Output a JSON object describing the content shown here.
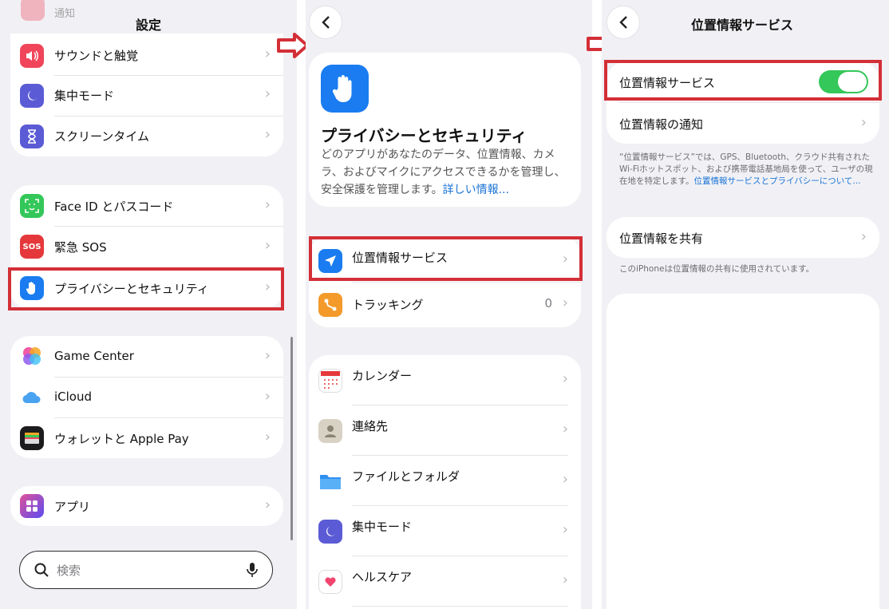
{
  "panel1": {
    "title": "設定",
    "top_partial": "通知",
    "group1": [
      {
        "label": "サウンドと触覚",
        "icon": "speaker-icon",
        "color": "#f0455a"
      },
      {
        "label": "集中モード",
        "icon": "moon-icon",
        "color": "#5b5bd6"
      },
      {
        "label": "スクリーンタイム",
        "icon": "hourglass-icon",
        "color": "#5b5bd6"
      }
    ],
    "group2": [
      {
        "label": "Face ID とパスコード",
        "icon": "face-id-icon",
        "color": "#34c759"
      },
      {
        "label": "緊急 SOS",
        "icon": "sos-icon",
        "color": "#e5383b",
        "icon_text": "SOS"
      },
      {
        "label": "プライバシーとセキュリティ",
        "icon": "hand-icon",
        "color": "#1a7cf0"
      }
    ],
    "group3": [
      {
        "label": "Game Center",
        "icon": "game-center-icon",
        "color": "#e85bb0"
      },
      {
        "label": "iCloud",
        "icon": "cloud-icon",
        "color": "#4aa3f0"
      },
      {
        "label": "ウォレットと Apple Pay",
        "icon": "wallet-icon",
        "color": "#1c1c1e"
      }
    ],
    "group4": [
      {
        "label": "アプリ",
        "icon": "apps-grid-icon",
        "color": "#6a4ee8"
      }
    ],
    "search_placeholder": "検索"
  },
  "panel2": {
    "header_title": "プライバシーとセキュリティ",
    "header_desc": "どのアプリがあなたのデータ、位置情報、カメラ、およびマイクにアクセスできるかを管理し、安全保護を管理します。",
    "header_link": "詳しい情報...",
    "group1": [
      {
        "label": "位置情報サービス",
        "icon": "location-arrow-icon",
        "color": "#1a7cf0"
      },
      {
        "label": "トラッキング",
        "icon": "tracking-icon",
        "color": "#f39a2b",
        "value": "0"
      }
    ],
    "group2": [
      {
        "label": "カレンダー",
        "icon": "calendar-icon"
      },
      {
        "label": "連絡先",
        "icon": "contacts-icon"
      },
      {
        "label": "ファイルとフォルダ",
        "icon": "folder-icon"
      },
      {
        "label": "集中モード",
        "icon": "moon-icon"
      },
      {
        "label": "ヘルスケア",
        "icon": "heart-icon"
      }
    ]
  },
  "panel3": {
    "title": "位置情報サービス",
    "toggle_label": "位置情報サービス",
    "toggle_on": true,
    "notify_label": "位置情報の通知",
    "note1": "“位置情報サービス”では、GPS、Bluetooth、クラウド共有されたWi-Fiホットスポット、および携帯電話基地局を使って、ユーザの現在地を特定します。",
    "note1_link": "位置情報サービスとプライバシーについて...",
    "share_label": "位置情報を共有",
    "note2": "このiPhoneは位置情報の共有に使用されています。"
  },
  "colors": {
    "highlight": "#d32f37",
    "accent": "#1a73d6",
    "toggle_on": "#34c759"
  }
}
